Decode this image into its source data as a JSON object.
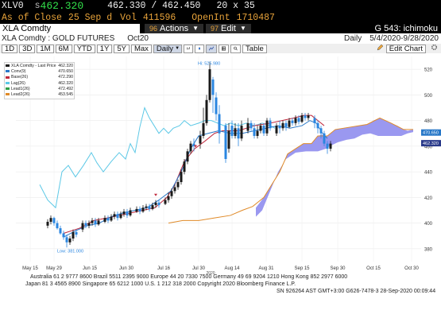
{
  "header": {
    "ticker": "XLV0",
    "last_prefix": "s",
    "last_price": "462.320",
    "bid_ask": "462.330 / 462.450",
    "size": "20 x 35",
    "asof_label": "As of Close",
    "asof_date": "25 Sep d",
    "vol_label": "Vol",
    "vol_value": "411596",
    "oi_label": "OpenInt",
    "oi_value": "1710487"
  },
  "toolbar": {
    "security": "XLA Comdty",
    "actions_num": "96",
    "actions_label": "Actions",
    "edit_num": "97",
    "edit_label": "Edit",
    "page_title": "G 543: ichimoku"
  },
  "subheader": {
    "description": "XLA Comdty : GOLD FUTURES",
    "contract": "Oct20",
    "period_label": "Daily",
    "range": "5/4/2020-9/28/2020"
  },
  "tools": {
    "ranges": [
      "1D",
      "3D",
      "1M",
      "6M",
      "YTD",
      "1Y",
      "5Y",
      "Max"
    ],
    "period": "Daily",
    "table_label": "Table",
    "edit_chart_label": "Edit Chart",
    "icons": [
      "bars-icon",
      "candle-icon",
      "line-icon",
      "table-icon",
      "magnifier-icon",
      "pencil-icon",
      "gear-icon"
    ]
  },
  "legend": {
    "title": "XLA Comdty - Last Price",
    "title_value": "462.320",
    "items": [
      {
        "label": "Conv(9)",
        "value": "470.650",
        "color": "#2878c8"
      },
      {
        "label": "Base(26)",
        "value": "472.290",
        "color": "#c0283c"
      },
      {
        "label": "Lag(26)",
        "value": "462.320",
        "color": "#5cc8e6"
      },
      {
        "label": "Lead1(26)",
        "value": "472.492",
        "color": "#2e9e46"
      },
      {
        "label": "Lead2(26)",
        "value": "453.545",
        "color": "#e08a28"
      }
    ]
  },
  "annotations": {
    "high": "Hi: 525.980",
    "low": "Low: 381.000"
  },
  "price_tags": [
    "470.650",
    "462.320"
  ],
  "chart_data": {
    "type": "candlestick",
    "x_ticks": [
      "May 15",
      "May 29",
      "Jun 15",
      "Jun 30",
      "Jul 16",
      "Jul 30",
      "Aug 14",
      "Aug 31",
      "Sep 15",
      "Sep 30",
      "Oct 15",
      "Oct 30"
    ],
    "x_sublabel": "2020",
    "y_ticks": [
      380,
      400,
      420,
      440,
      460,
      480,
      500,
      520
    ],
    "ylim": [
      370,
      530
    ],
    "series": [
      "Last Price",
      "Conv(9)",
      "Base(26)",
      "Lag(26)",
      "Lead1(26)",
      "Lead2(26)"
    ],
    "high": 525.98,
    "low": 381.0
  },
  "footer": {
    "line1": "Australia 61 2 9777 8600 Brazil 5511 2395 9000 Europe 44 20 7330 7500 Germany 49 69 9204 1210 Hong Kong 852 2977 6000",
    "line2": "Japan 81 3 4565 8900 Singapore 65 6212 1000 U.S. 1 212 318 2000 Copyright 2020 Bloomberg Finance L.P.",
    "line3": "SN 926264 AST GMT+3:00 G626-7478-3 28-Sep-2020 00:09:44"
  }
}
